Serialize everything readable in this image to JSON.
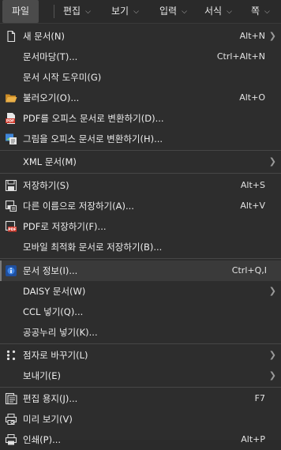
{
  "menubar": {
    "file": "파일",
    "edit": "편집",
    "view": "보기",
    "input": "입력",
    "format": "서식",
    "page": "쪽"
  },
  "menu": {
    "new": {
      "label": "새 문서(N)",
      "shortcut": "Alt+N"
    },
    "template": {
      "label": "문서마당(T)...",
      "shortcut": "Ctrl+Alt+N"
    },
    "start_wizard": {
      "label": "문서 시작 도우미(G)"
    },
    "open": {
      "label": "불러오기(O)...",
      "shortcut": "Alt+O"
    },
    "pdf_to_office": {
      "label": "PDF를 오피스 문서로 변환하기(D)..."
    },
    "image_to_office": {
      "label": "그림을 오피스 문서로 변환하기(H)..."
    },
    "xml": {
      "label": "XML 문서(M)"
    },
    "save": {
      "label": "저장하기(S)",
      "shortcut": "Alt+S"
    },
    "save_as": {
      "label": "다른 이름으로 저장하기(A)...",
      "shortcut": "Alt+V"
    },
    "save_pdf": {
      "label": "PDF로 저장하기(F)..."
    },
    "save_mobile": {
      "label": "모바일 최적화 문서로 저장하기(B)..."
    },
    "doc_info": {
      "label": "문서 정보(I)...",
      "shortcut": "Ctrl+Q,I"
    },
    "daisy": {
      "label": "DAISY 문서(W)"
    },
    "ccl": {
      "label": "CCL 넣기(Q)..."
    },
    "kogl": {
      "label": "공공누리 넣기(K)..."
    },
    "braille": {
      "label": "점자로 바꾸기(L)"
    },
    "send": {
      "label": "보내기(E)"
    },
    "page_setup": {
      "label": "편집 용지(J)...",
      "shortcut": "F7"
    },
    "preview": {
      "label": "미리 보기(V)"
    },
    "print": {
      "label": "인쇄(P)...",
      "shortcut": "Alt+P"
    }
  },
  "colors": {
    "background": "#2d2d2d",
    "highlight": "#3a3a3a",
    "pdf_red": "#d23b2e",
    "folder": "#e0a33a",
    "info_blue": "#2f6fd6"
  }
}
